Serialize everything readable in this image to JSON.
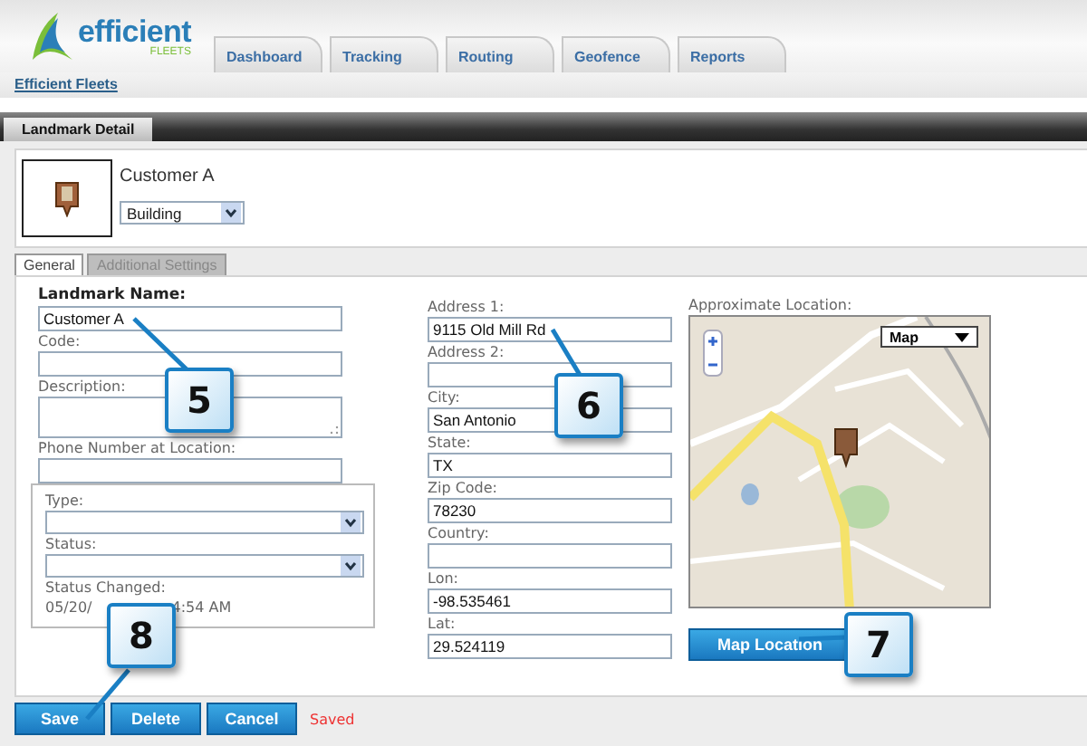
{
  "logo": {
    "word": "efficient",
    "sub": "FLEETS"
  },
  "tabs": [
    {
      "label": "Dashboard",
      "selected": false
    },
    {
      "label": "Tracking",
      "selected": false
    },
    {
      "label": "Routing",
      "selected": false
    },
    {
      "label": "Geofence",
      "selected": false
    },
    {
      "label": "Reports",
      "selected": false
    }
  ],
  "breadcrumb": "Efficient Fleets",
  "section_title": "Landmark Detail",
  "landmark": {
    "name": "Customer A",
    "category": "Building"
  },
  "form_tabs": [
    {
      "label": "General",
      "selected": true
    },
    {
      "label": "Additional Settings",
      "selected": false
    }
  ],
  "left_fields": [
    {
      "label": "Landmark Name:",
      "value": "Customer A",
      "kind": "input",
      "bold": true
    },
    {
      "label": "Code:",
      "kind": "input",
      "bold": false
    },
    {
      "label": "Description:",
      "kind": "textarea",
      "bold": false
    },
    {
      "label": "Phone Number at Location:",
      "kind": "input",
      "bold": false
    }
  ],
  "group": {
    "type_label": "Type:",
    "status_label": "Status:",
    "changed_label": "Status Changed:",
    "changed_parts": [
      "05/20/",
      "4:54 AM"
    ]
  },
  "address_fields": [
    {
      "label": "Address 1:",
      "value": "9115 Old Mill Rd"
    },
    {
      "label": "Address 2:"
    },
    {
      "label": "City:",
      "value": "San Antonio"
    },
    {
      "label": "State:",
      "value": "TX"
    },
    {
      "label": "Zip Code:",
      "value": "78230"
    },
    {
      "label": "Country:"
    },
    {
      "label": "Lon:",
      "value": "-98.535461"
    },
    {
      "label": "Lat:",
      "value": "29.524119"
    }
  ],
  "map": {
    "label": "Approximate Location:",
    "map_type": "Map",
    "button": "Map Location"
  },
  "buttons": [
    "Save",
    "Delete",
    "Cancel"
  ],
  "status_message": "Saved",
  "callouts": [
    {
      "number": "5"
    },
    {
      "number": "6"
    },
    {
      "number": "7"
    },
    {
      "number": "8"
    }
  ]
}
